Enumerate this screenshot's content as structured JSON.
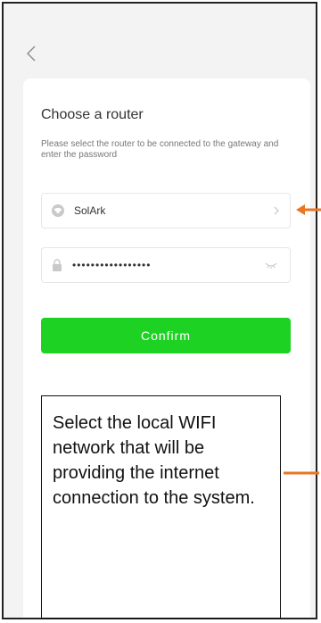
{
  "screen": {
    "title": "Choose a router",
    "description": "Please select the router to be connected to the gateway and enter the password"
  },
  "router_field": {
    "value": "SolArk",
    "icon": "wifi-icon"
  },
  "password_field": {
    "value": "•••••••••••••••••",
    "icon": "lock-icon"
  },
  "confirm": {
    "label": "Confirm",
    "color": "#1ed223"
  },
  "callout": {
    "text": "Select the local WIFI network that will be providing the internet connection to the system."
  },
  "annotation": {
    "arrow_color": "#e87722"
  }
}
